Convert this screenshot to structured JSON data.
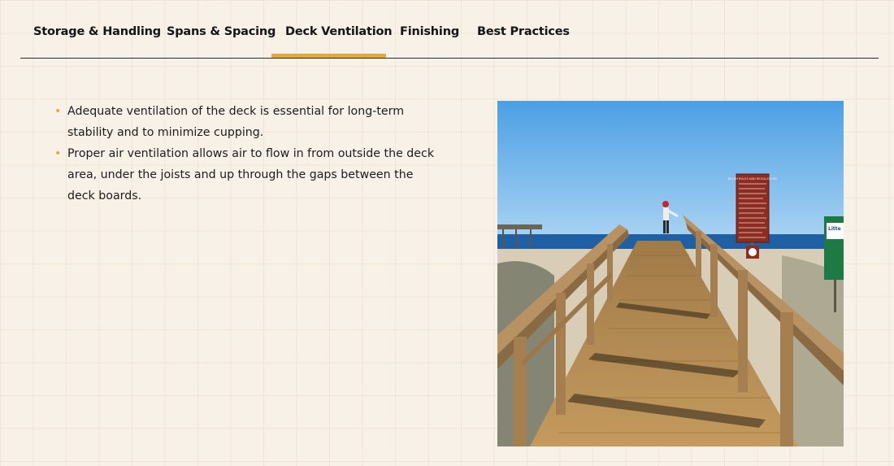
{
  "tabs": {
    "items": [
      {
        "label": "Storage & Handling"
      },
      {
        "label": "Spans & Spacing"
      },
      {
        "label": "Deck Ventilation"
      },
      {
        "label": "Finishing"
      },
      {
        "label": "Best Practices"
      }
    ],
    "active": "Deck Ventilation"
  },
  "content": {
    "bullets": [
      "Adequate ventilation of the deck is essential for long-term stability and to minimize cupping.",
      "Proper air ventilation allows air to flow in from outside the deck area, under the joists and up through the gaps between the deck boards."
    ]
  },
  "photo": {
    "sign_title": "BEACH RULES AND REGULATIONS",
    "side_sign_text": "Litte"
  },
  "colors": {
    "accent": "#e6a934",
    "background": "#f8f1e7",
    "divider": "#2b2b2b"
  }
}
